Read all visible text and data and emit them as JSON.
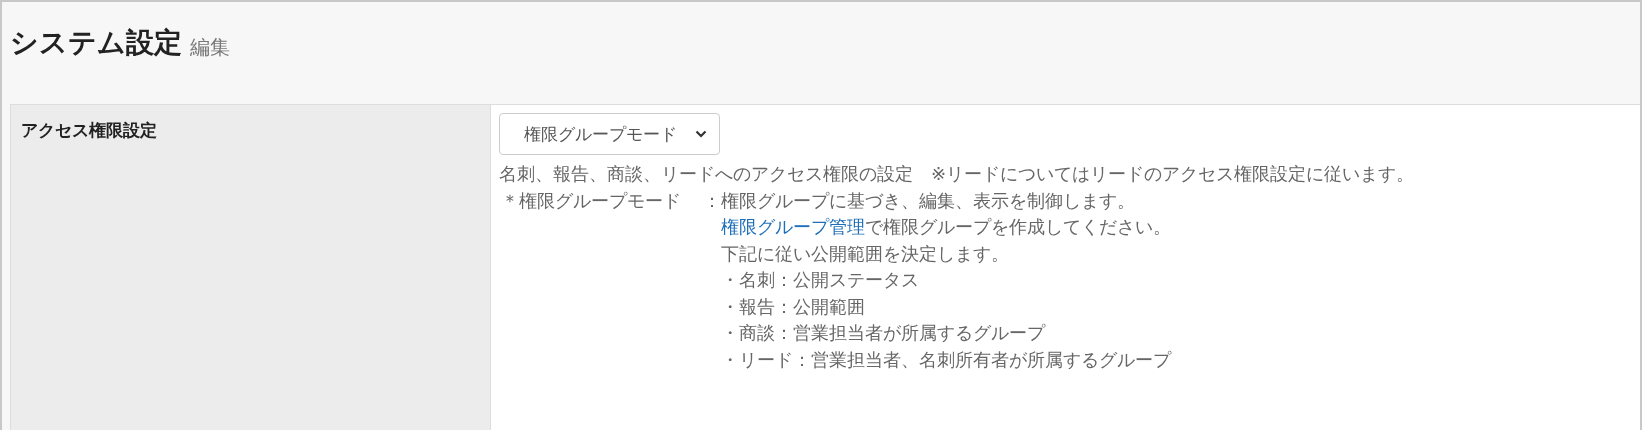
{
  "header": {
    "title": "システム設定",
    "subtitle": "編集"
  },
  "settings": [
    {
      "label": "アクセス権限設定",
      "select": {
        "value": "権限グループモード"
      },
      "description": "名刺、報告、商談、リードへのアクセス権限の設定　※リードについてはリードのアクセス権限設定に従います。",
      "mode": {
        "term": "＊権限グループモード",
        "separator": "：",
        "lines": [
          {
            "text": "権限グループに基づき、編集、表示を制御します。"
          },
          {
            "link": "権限グループ管理",
            "text": "で権限グループを作成してください。"
          },
          {
            "text": "下記に従い公開範囲を決定します。"
          },
          {
            "text": "・名刺：公開ステータス"
          },
          {
            "text": "・報告：公開範囲"
          },
          {
            "text": "・商談：営業担当者が所属するグループ"
          },
          {
            "text": "・リード：営業担当者、名刺所有者が所属するグループ"
          }
        ]
      }
    }
  ]
}
